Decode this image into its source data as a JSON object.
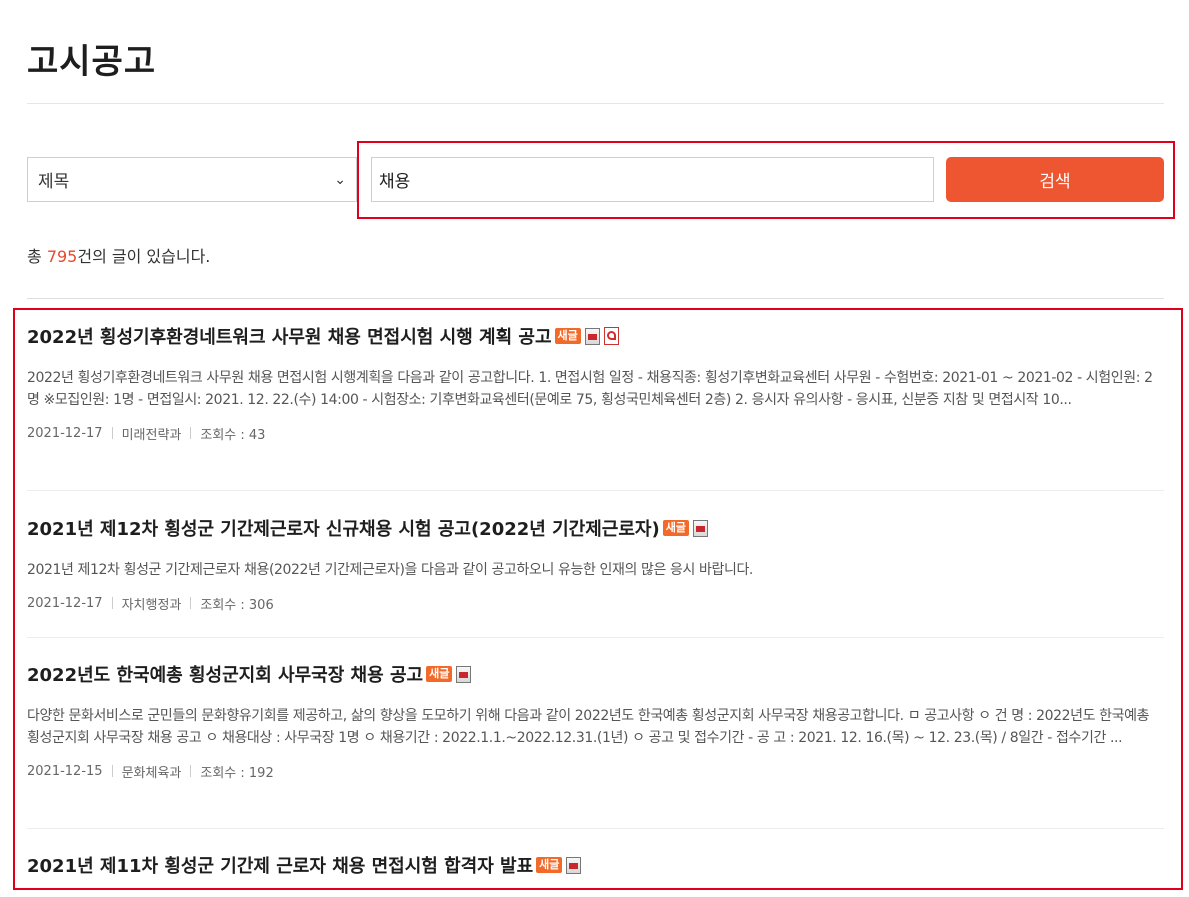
{
  "page": {
    "title": "고시공고"
  },
  "search": {
    "field_selected": "제목",
    "query": "채용",
    "button_label": "검색"
  },
  "summary": {
    "prefix": "총 ",
    "count": "795",
    "suffix": "건의 글이 있습니다."
  },
  "icons": {
    "new_badge": "새글",
    "attachment": "hwp-file-icon",
    "pdf": "pdf-file-icon"
  },
  "posts": [
    {
      "title": "2022년 횡성기후환경네트워크 사무원 채용 면접시험 시행 계획 공고",
      "summary": "2022년 횡성기후환경네트워크 사무원 채용 면접시험 시행계획을 다음과 같이 공고합니다. 1. 면접시험 일정 - 채용직종: 횡성기후변화교육센터 사무원 - 수험번호: 2021-01 ~ 2021-02 - 시험인원: 2명 ※모집인원: 1명 - 면접일시: 2021. 12. 22.(수) 14:00 - 시험장소: 기후변화교육센터(문예로 75, 횡성국민체육센터 2층) 2. 응시자 유의사항 - 응시표, 신분증 지참 및 면접시작 10...",
      "date": "2021-12-17",
      "dept": "미래전략과",
      "views": "조회수 : 43"
    },
    {
      "title": "2021년 제12차 횡성군 기간제근로자 신규채용 시험 공고(2022년 기간제근로자)",
      "summary": "2021년 제12차 횡성군 기간제근로자 채용(2022년 기간제근로자)을 다음과 같이 공고하오니 유능한 인재의 많은 응시 바랍니다.",
      "date": "2021-12-17",
      "dept": "자치행정과",
      "views": "조회수 : 306"
    },
    {
      "title": "2022년도 한국예총 횡성군지회 사무국장 채용 공고",
      "summary": "다양한 문화서비스로 군민들의 문화향유기회를 제공하고, 삶의 향상을 도모하기 위해 다음과 같이 2022년도 한국예총 횡성군지회 사무국장 채용공고합니다. ㅁ 공고사항 ㅇ 건 명 : 2022년도 한국예총 횡성군지회 사무국장 채용 공고 ㅇ 채용대상 : 사무국장 1명 ㅇ 채용기간 : 2022.1.1.~2022.12.31.(1년) ㅇ 공고 및 접수기간 - 공 고 : 2021. 12. 16.(목) ~ 12. 23.(목) / 8일간 - 접수기간 ...",
      "date": "2021-12-15",
      "dept": "문화체육과",
      "views": "조회수 : 192"
    },
    {
      "title": "2021년 제11차 횡성군 기간제 근로자 채용 면접시험 합격자 발표"
    }
  ]
}
